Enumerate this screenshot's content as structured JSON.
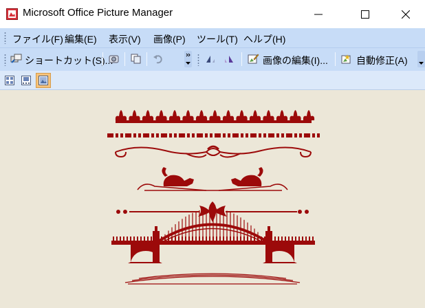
{
  "window": {
    "title": "Microsoft Office Picture Manager",
    "app_icon": "picture-manager-icon"
  },
  "menu": {
    "items": [
      {
        "label": "ファイル(F)"
      },
      {
        "label": "編集(E)"
      },
      {
        "label": "表示(V)"
      },
      {
        "label": "画像(P)"
      },
      {
        "label": "ツール(T)"
      },
      {
        "label": "ヘルプ(H)"
      }
    ]
  },
  "toolbar": {
    "shortcut_label": "ショートカット(S)...",
    "edit_picture_label": "画像の編集(I)...",
    "auto_correct_label": "自動修正(A)",
    "icons": [
      "shortcut-icon",
      "import-icon",
      "copy-icon",
      "undo-icon",
      "rotate-left-icon",
      "rotate-right-icon",
      "edit-picture-icon",
      "auto-correct-icon"
    ]
  },
  "viewbar": {
    "icons": [
      "thumbnail-view-icon",
      "filmstrip-view-icon",
      "single-picture-view-icon"
    ],
    "active": "single-picture-view-icon"
  },
  "colors": {
    "ornament": "#9c0a0a",
    "content_bg": "#ece7d8",
    "menubar_bg": "#c7dcf7"
  }
}
